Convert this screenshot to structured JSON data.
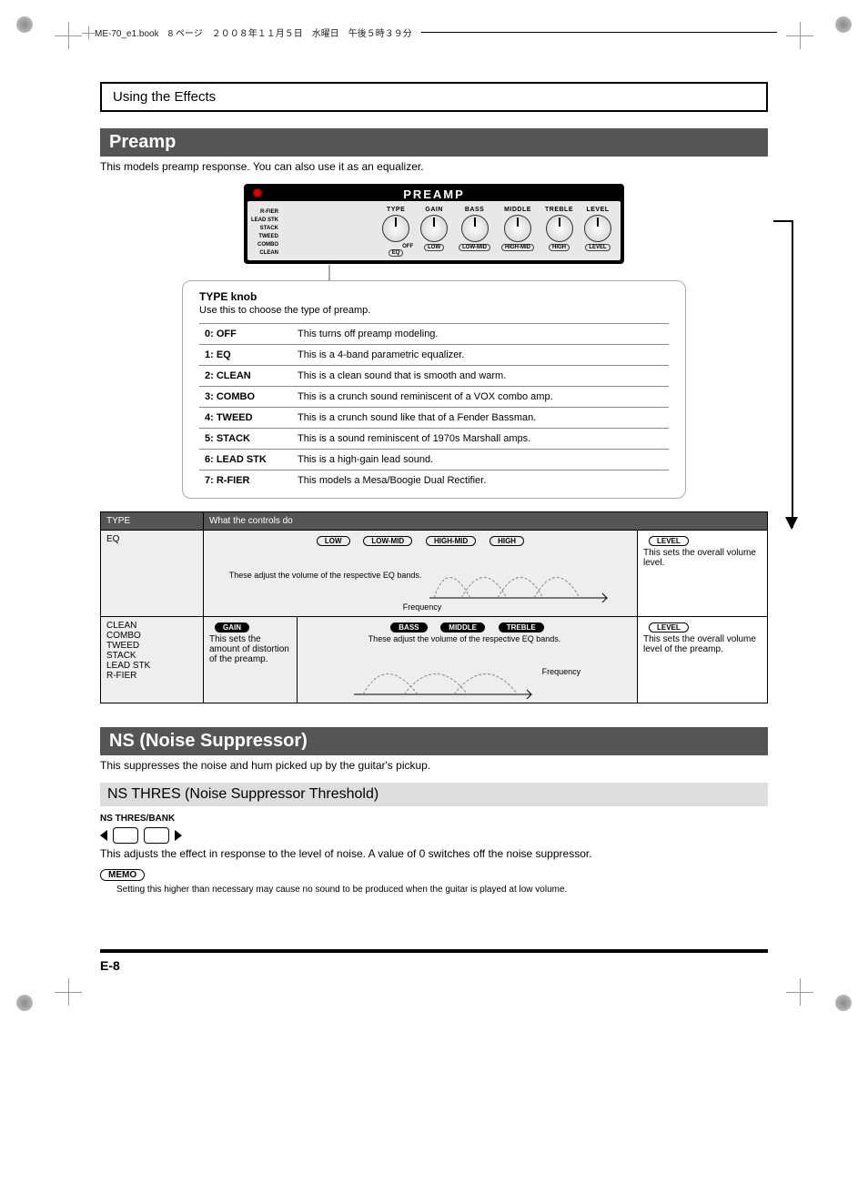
{
  "print_header": "ME-70_e1.book　8 ページ　２００８年１１月５日　水曜日　午後５時３９分",
  "section_header": "Using the Effects",
  "preamp": {
    "title": "Preamp",
    "desc": "This models preamp response. You can also use it as an equalizer.",
    "panel_title": "PREAMP",
    "knobs": [
      {
        "top": "TYPE",
        "bot": "EQ"
      },
      {
        "top": "GAIN",
        "bot": "LOW"
      },
      {
        "top": "BASS",
        "bot": "LOW-MID"
      },
      {
        "top": "MIDDLE",
        "bot": "HIGH-MID"
      },
      {
        "top": "TREBLE",
        "bot": "HIGH"
      },
      {
        "top": "LEVEL",
        "bot": "LEVEL"
      }
    ],
    "type_side_labels": [
      "R-FIER",
      "LEAD STK",
      "STACK",
      "TWEED",
      "COMBO",
      "CLEAN"
    ],
    "off_label": "OFF"
  },
  "type_knob": {
    "heading": "TYPE knob",
    "sub": "Use this to choose the type of preamp.",
    "rows": [
      {
        "k": "0: OFF",
        "v": "This turns off preamp modeling."
      },
      {
        "k": "1: EQ",
        "v": "This is a 4-band parametric equalizer."
      },
      {
        "k": "2: CLEAN",
        "v": "This is a clean sound that is smooth and warm."
      },
      {
        "k": "3: COMBO",
        "v": "This is a crunch sound reminiscent of a VOX combo amp."
      },
      {
        "k": "4: TWEED",
        "v": "This is a crunch sound like that of a Fender Bassman."
      },
      {
        "k": "5: STACK",
        "v": "This is a sound reminiscent of 1970s Marshall amps."
      },
      {
        "k": "6: LEAD STK",
        "v": "This is a high-gain lead sound."
      },
      {
        "k": "7: R-FIER",
        "v": "This models a Mesa/Boogie Dual Rectifier."
      }
    ]
  },
  "ctrl_table": {
    "head_type": "TYPE",
    "head_what": "What the controls do",
    "eq_row_type": "EQ",
    "eq_bands": [
      "LOW",
      "LOW-MID",
      "HIGH-MID",
      "HIGH"
    ],
    "eq_text": "These adjust the volume of the respective EQ bands.",
    "eq_freq": "Frequency",
    "eq_level_pill": "LEVEL",
    "eq_level_text": "This sets the overall volume level.",
    "amp_row_types": "CLEAN\nCOMBO\nTWEED\nSTACK\nLEAD STK\nR-FIER",
    "gain_pill": "GAIN",
    "gain_text": "This sets the amount of distortion of the preamp.",
    "amp_bands": [
      "BASS",
      "MIDDLE",
      "TREBLE"
    ],
    "amp_text": "These adjust the volume of the respective EQ bands.",
    "amp_freq": "Frequency",
    "amp_level_pill": "LEVEL",
    "amp_level_text": "This sets the overall volume level of the preamp."
  },
  "ns": {
    "title": "NS (Noise Suppressor)",
    "desc": "This suppresses the noise and hum picked up by the guitar's pickup.",
    "sub_title": "NS THRES (Noise Suppressor Threshold)",
    "icon_label": "NS THRES/BANK",
    "adjust_text": "This adjusts the effect in response to the level of noise. A value of 0 switches off the noise suppressor.",
    "memo_badge": "MEMO",
    "memo_text": "Setting this higher than necessary may cause no sound to be produced when the guitar is played at low volume."
  },
  "page_number": "E-8"
}
